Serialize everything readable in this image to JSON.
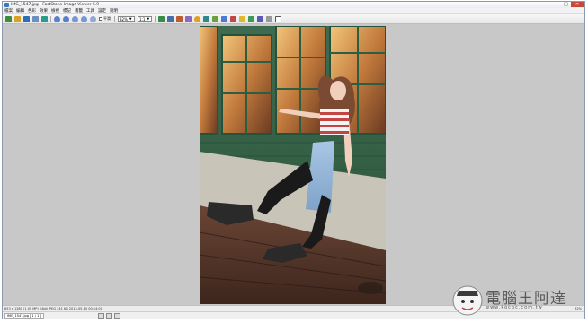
{
  "window": {
    "title": "IMG_1547.jpg - FastStone Image Viewer 5.9",
    "controls": {
      "minimize": "—",
      "maximize": "□",
      "close": "✕"
    }
  },
  "menu": [
    "檔案",
    "編輯",
    "色彩",
    "效果",
    "檢視",
    "標記",
    "書籤",
    "工具",
    "設定",
    "說明"
  ],
  "toolbar": {
    "smooth_label": "平滑",
    "zoom_value": "32%",
    "fit_value": "1:1",
    "icons": [
      "open-icon",
      "browse-icon",
      "save-icon",
      "print-icon",
      "email-icon",
      "prev-icon",
      "next-icon",
      "zoom-in-icon",
      "zoom-out-icon",
      "rotate-icon",
      "crop-icon",
      "resize-icon",
      "color-icon",
      "sharpen-icon",
      "slideshow-icon",
      "fullscreen-icon"
    ]
  },
  "photo": {
    "alt_icon": "photo-image"
  },
  "status": {
    "info": "853 x 1280 (1.09 MP)  24bit  JPEG  241 KB  2015-05-10 00:14:00",
    "zoom": "32%"
  },
  "taskbar": {
    "file_tab": "IMG_1547.jpg  [ 1 / 1 ]"
  },
  "watermark": {
    "brand": "電腦王阿達",
    "sub": "www.kocpc.com.tw"
  }
}
